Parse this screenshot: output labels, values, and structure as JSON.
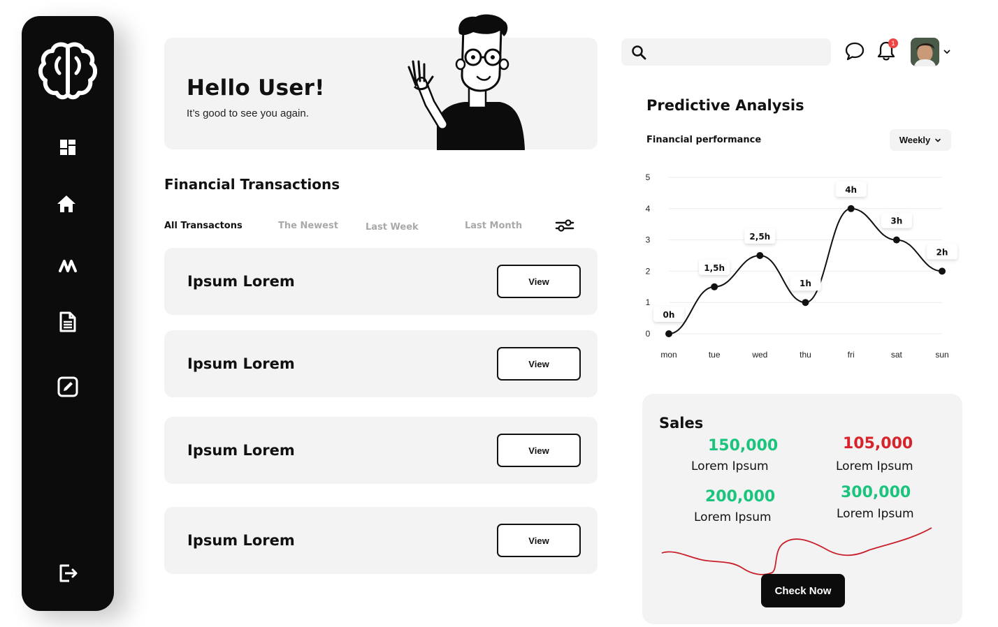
{
  "hello": {
    "title": "Hello User!",
    "subtitle": "It’s good to see you again."
  },
  "transactions": {
    "title": "Financial Transactions",
    "tabs": [
      {
        "label": "All Transactons",
        "active": true
      },
      {
        "label": "The Newest",
        "active": false
      },
      {
        "label": "Last Week",
        "active": false
      },
      {
        "label": "Last Month",
        "active": false
      }
    ],
    "items": [
      {
        "name": "Ipsum Lorem",
        "button": "View"
      },
      {
        "name": "Ipsum Lorem",
        "button": "View"
      },
      {
        "name": "Ipsum Lorem",
        "button": "View"
      },
      {
        "name": "Ipsum Lorem",
        "button": "View"
      }
    ]
  },
  "topbar": {
    "search_placeholder": "",
    "notification_count": "1"
  },
  "predictive": {
    "title": "Predictive Analysis",
    "subtitle": "Financial  performance",
    "period": "Weekly"
  },
  "chart_data": {
    "type": "line",
    "title": "Financial  performance",
    "categories": [
      "mon",
      "tue",
      "wed",
      "thu",
      "fri",
      "sat",
      "sun"
    ],
    "values": [
      0,
      1.5,
      2.5,
      1,
      4,
      3,
      2
    ],
    "data_labels": [
      "0h",
      "1,5h",
      "2,5h",
      "1h",
      "4h",
      "3h",
      "2h"
    ],
    "y_ticks": [
      0,
      1,
      2,
      3,
      4,
      5
    ],
    "ylim": [
      0,
      5
    ],
    "xlabel": "",
    "ylabel": "",
    "grid": true,
    "line_color": "#111111"
  },
  "sales": {
    "title": "Sales",
    "stats": [
      {
        "value": "150,000",
        "label": "Lorem Ipsum",
        "color": "#1bc47d"
      },
      {
        "value": "105,000",
        "label": "Lorem Ipsum",
        "color": "#d8232a"
      },
      {
        "value": "200,000",
        "label": "Lorem Ipsum",
        "color": "#1bc47d"
      },
      {
        "value": "300,000",
        "label": "Lorem Ipsum",
        "color": "#1bc47d"
      }
    ],
    "wave_color": "#c8202a",
    "cta": "Check Now"
  },
  "colors": {
    "sidebar": "#0c0c0c",
    "card": "#f3f3f4",
    "accent_green": "#1bc47d",
    "accent_red": "#d8232a"
  }
}
